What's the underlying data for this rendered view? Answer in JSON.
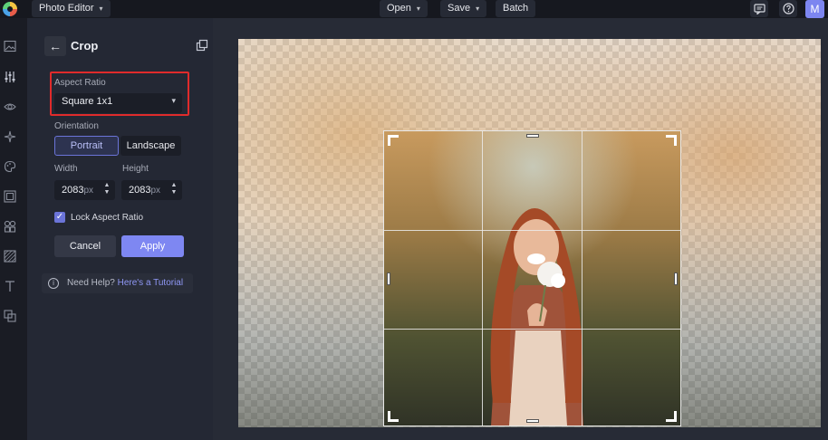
{
  "topbar": {
    "app_menu_label": "Photo Editor",
    "open_label": "Open",
    "save_label": "Save",
    "batch_label": "Batch",
    "avatar_initial": "M"
  },
  "rail": {
    "icons": [
      "image-icon",
      "adjust-sliders-icon",
      "eye-icon",
      "sparkle-effects-icon",
      "palette-icon",
      "frame-icon",
      "shapes-icon",
      "texture-icon",
      "text-icon",
      "layers-icon"
    ]
  },
  "crop_panel": {
    "title": "Crop",
    "aspect_ratio_label": "Aspect Ratio",
    "aspect_ratio_value": "Square 1x1",
    "orientation_label": "Orientation",
    "orientation_options": [
      "Portrait",
      "Landscape"
    ],
    "orientation_selected": "Portrait",
    "width_label": "Width",
    "height_label": "Height",
    "width_value": "2083",
    "height_value": "2083",
    "unit": "px",
    "lock_aspect_label": "Lock Aspect Ratio",
    "lock_aspect_checked": true,
    "cancel_label": "Cancel",
    "apply_label": "Apply",
    "help_text": "Need Help?",
    "help_link": "Here's a Tutorial"
  },
  "colors": {
    "accent": "#7e87f2",
    "highlight": "#e02b2b",
    "panel_bg": "#242834",
    "topbar_bg": "#16181f"
  }
}
